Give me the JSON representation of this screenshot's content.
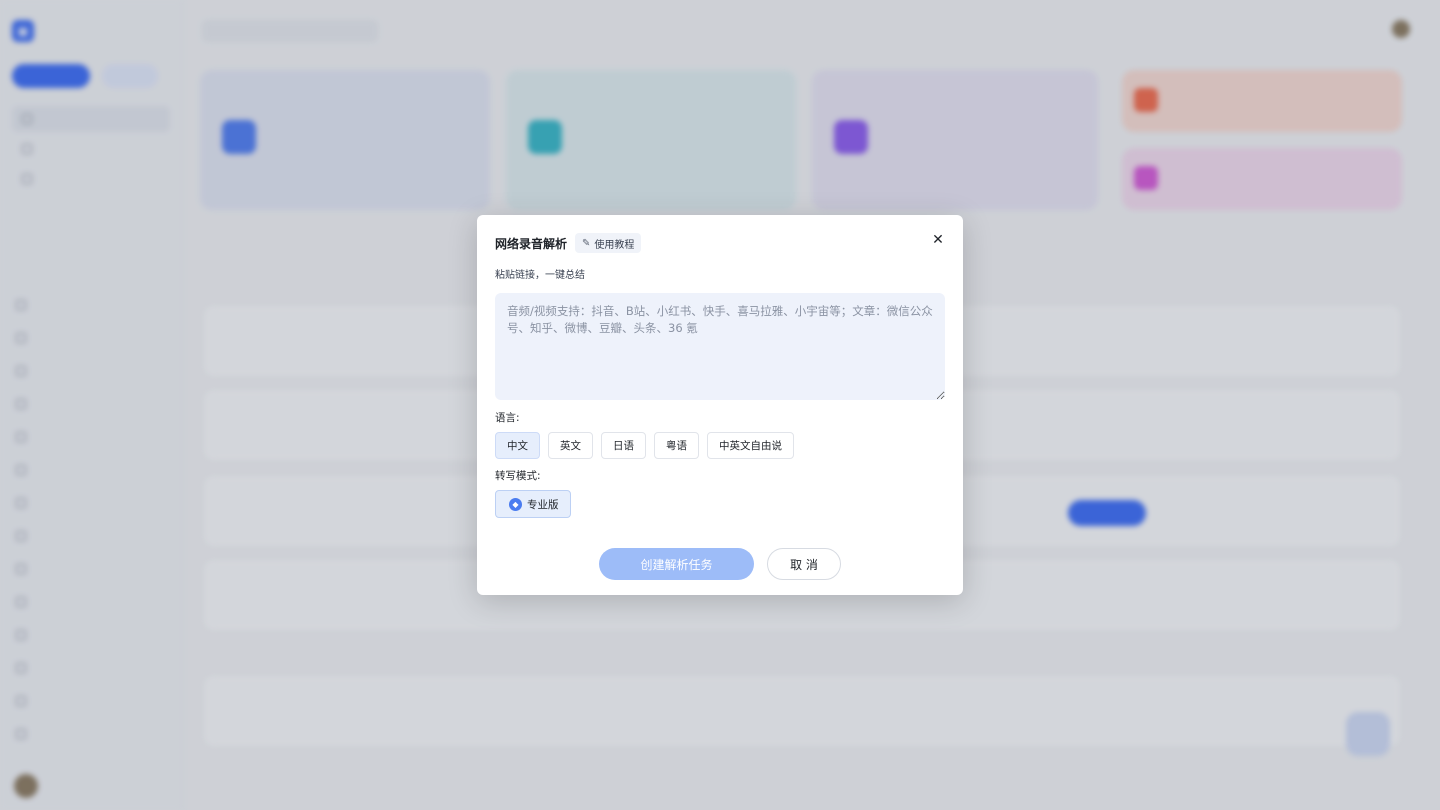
{
  "modal": {
    "title": "网络录音解析",
    "tutorial_label": "使用教程",
    "close_icon": "close-icon",
    "subtitle": "粘贴链接，一键总结",
    "link_input": {
      "value": "",
      "placeholder": "音频/视频支持：抖音、B站、小红书、快手、喜马拉雅、小宇宙等；文章：微信公众号、知乎、微博、豆瓣、头条、36 氪"
    },
    "language_label": "语言:",
    "languages": [
      "中文",
      "英文",
      "日语",
      "粤语",
      "中英文自由说"
    ],
    "selected_language": "中文",
    "mode_label": "转写模式:",
    "mode_option": "专业版",
    "create_button": "创建解析任务",
    "cancel_button": "取 消"
  },
  "colors": {
    "accent": "#3b6cf6",
    "create_button_disabled": "#9dbcf8",
    "input_bg": "#eef2fb"
  }
}
